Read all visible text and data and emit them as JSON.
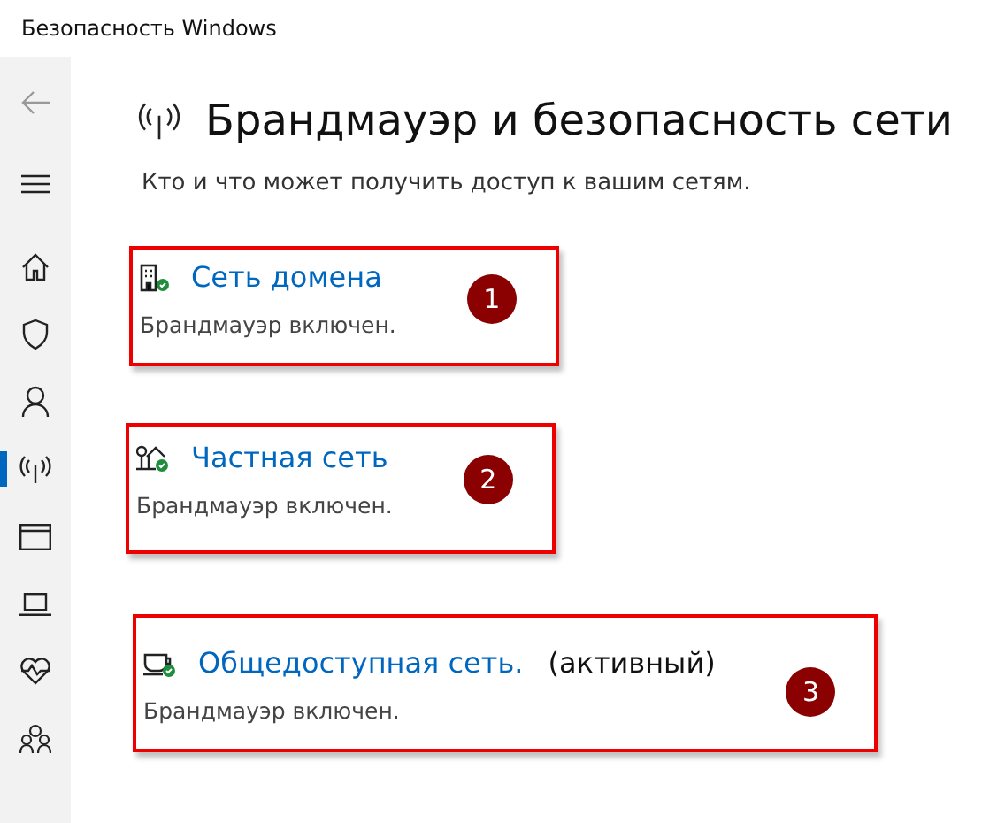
{
  "window": {
    "title": "Безопасность Windows"
  },
  "sidebar": {
    "items": [
      {
        "kind": "back",
        "selected": false
      },
      {
        "kind": "menu",
        "selected": false
      },
      {
        "kind": "home",
        "selected": false
      },
      {
        "kind": "shield",
        "selected": false
      },
      {
        "kind": "person",
        "selected": false
      },
      {
        "kind": "wifi",
        "selected": true
      },
      {
        "kind": "window",
        "selected": false
      },
      {
        "kind": "laptop",
        "selected": false
      },
      {
        "kind": "heart",
        "selected": false
      },
      {
        "kind": "family",
        "selected": false
      }
    ]
  },
  "page": {
    "title": "Брандмауэр и безопасность сети",
    "subtitle": "Кто и что может получить доступ к вашим сетям."
  },
  "networks": [
    {
      "kind": "domain",
      "name": "Сеть домена",
      "active": false,
      "status": "Брандмауэр включен.",
      "marker": "1"
    },
    {
      "kind": "private",
      "name": "Частная сеть",
      "active": false,
      "status": "Брандмауэр включен.",
      "marker": "2"
    },
    {
      "kind": "public",
      "name": "Общедоступная сеть.",
      "active": true,
      "active_label": "(активный)",
      "status": "Брандмауэр включен.",
      "marker": "3"
    }
  ]
}
